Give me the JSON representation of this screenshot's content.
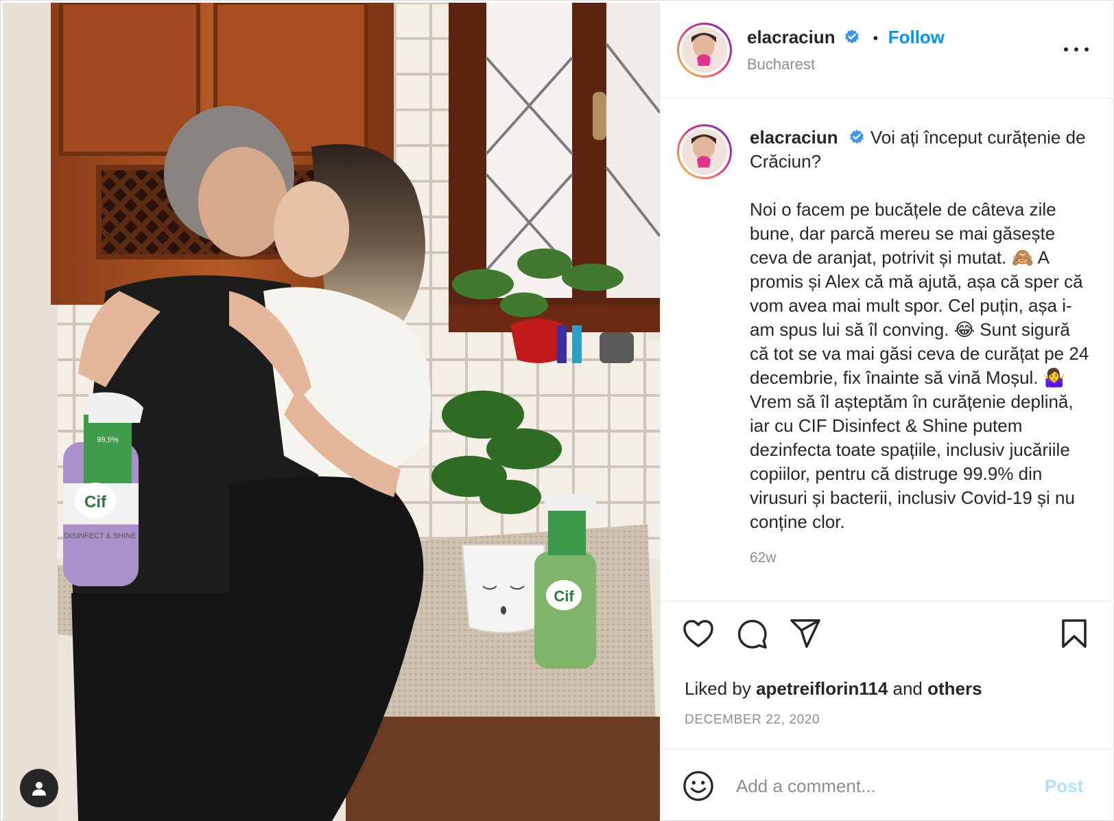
{
  "post": {
    "username": "elacraciun",
    "verified": true,
    "follow_label": "Follow",
    "location": "Bucharest",
    "caption_head": "Voi ați început curățenie de Crăciun?",
    "caption_body": "Noi o facem pe bucățele de câteva zile bune, dar parcă mereu se mai găsește ceva de aranjat, potrivit și mutat. 🙈 A promis și Alex că mă ajută, așa că sper că vom avea mai mult spor. Cel puțin, așa i-am spus lui să îl conving. 😂 Sunt sigură că tot se va mai găsi ceva de curățat pe 24 decembrie, fix înainte să vină Moșul. 🤷‍♀️ Vrem să îl așteptăm în curățenie deplină, iar cu CIF Disinfect & Shine putem dezinfecta toate spațiile, inclusiv jucăriile copiilor, pentru că distruge 99.9% din virusuri și bacterii, inclusiv Covid-19 și nu conține clor.",
    "time_ago": "62w",
    "liked_by_prefix": "Liked by",
    "liked_by_user": "apetreiflorin114",
    "liked_by_and": "and",
    "liked_by_others": "others",
    "date": "DECEMBER 22, 2020"
  },
  "comment": {
    "placeholder": "Add a comment...",
    "post_label": "Post"
  },
  "icons": {
    "like": "heart-icon",
    "comment": "comment-bubble-icon",
    "share": "paper-plane-icon",
    "save": "bookmark-icon",
    "emoji": "smiley-icon",
    "more": "more-options-icon",
    "user_tags": "user-icon",
    "verified": "verified-badge-icon"
  },
  "photo_labels": {
    "brand": "Cif",
    "product_line": "DISINFECT & SHINE",
    "claim": "99,9%"
  },
  "colors": {
    "link_blue": "#0095f6",
    "post_disabled": "#b2dffc",
    "secondary_text": "#8e8e8e"
  }
}
